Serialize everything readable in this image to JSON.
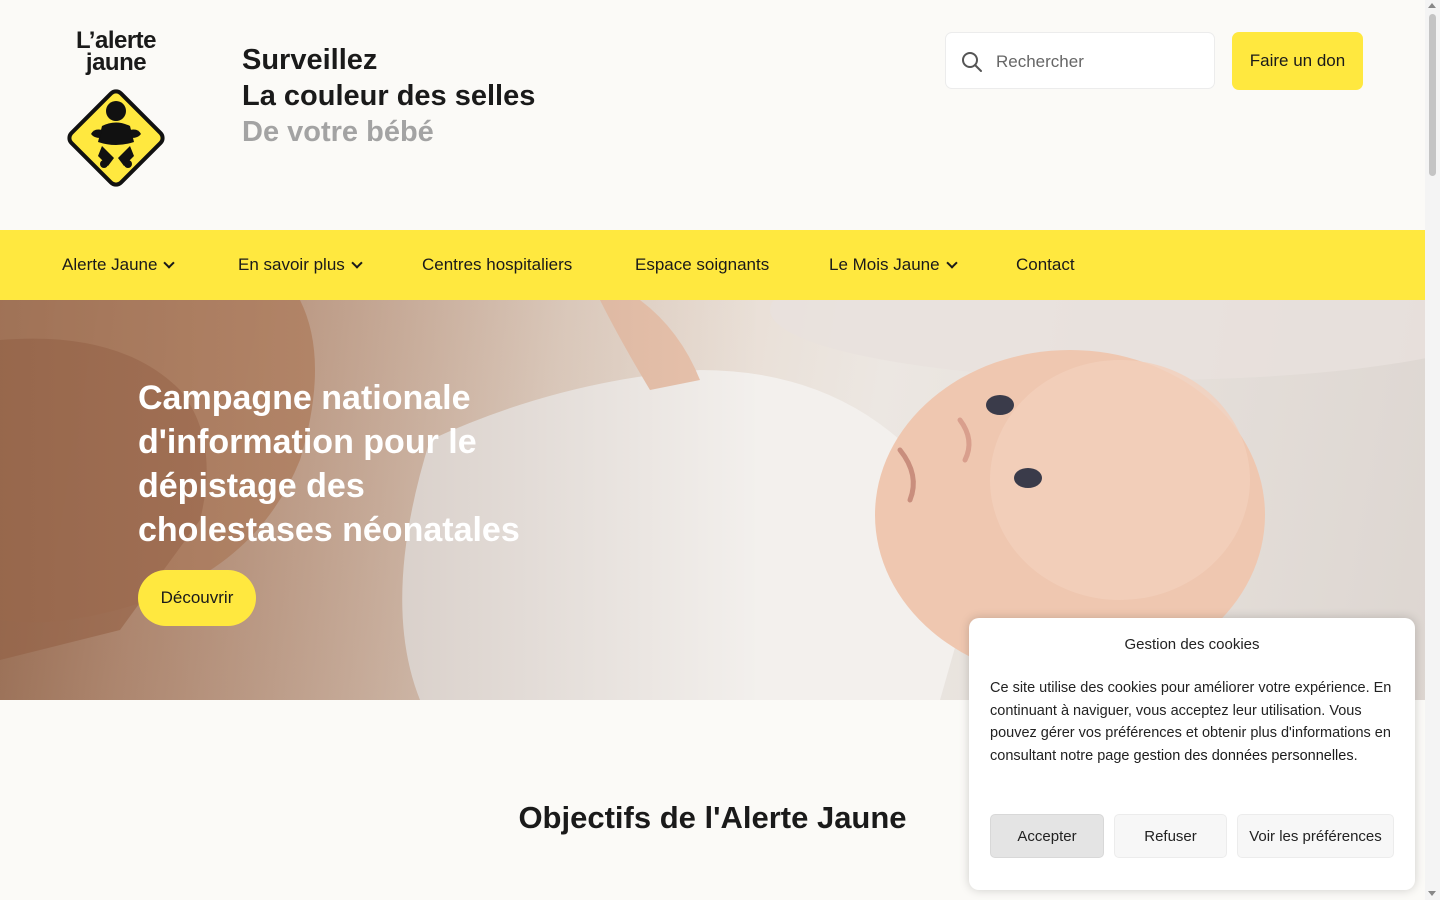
{
  "header": {
    "logo_line1": "L’alerte",
    "logo_line2": "jaune",
    "tagline_line1": "Surveillez",
    "tagline_line2": "La couleur des selles",
    "tagline_line3": "De votre bébé",
    "search_placeholder": "Rechercher",
    "donate_label": "Faire un don"
  },
  "nav": {
    "items": [
      {
        "label": "Alerte Jaune",
        "has_dropdown": true
      },
      {
        "label": "En savoir plus",
        "has_dropdown": true
      },
      {
        "label": "Centres hospitaliers",
        "has_dropdown": false
      },
      {
        "label": "Espace soignants",
        "has_dropdown": false
      },
      {
        "label": "Le Mois Jaune",
        "has_dropdown": true
      },
      {
        "label": "Contact",
        "has_dropdown": false
      }
    ]
  },
  "hero": {
    "title": "Campagne nationale d'information pour le dépistage des cholestases néonatales",
    "button_label": "Découvrir"
  },
  "section": {
    "title": "Objectifs de l'Alerte Jaune"
  },
  "cookie": {
    "title": "Gestion des cookies",
    "text": "Ce site utilise des cookies pour améliorer votre expérience. En continuant à naviguer, vous acceptez leur utilisation. Vous pouvez gérer vos préférences et obtenir plus d'informations en consultant notre page ",
    "link_text": "gestion des données personnelles",
    "text_end": ".",
    "accept_label": "Accepter",
    "refuse_label": "Refuser",
    "prefs_label": "Voir les préférences"
  },
  "colors": {
    "brand_yellow": "#ffe83f",
    "page_bg": "#fbfaf7",
    "text_dark": "#1a1a1a",
    "text_muted": "#a3a3a3"
  },
  "icons": {
    "search": "search-icon",
    "chevron": "chevron-down-icon",
    "logo_sign": "baby-warning-sign-icon"
  }
}
